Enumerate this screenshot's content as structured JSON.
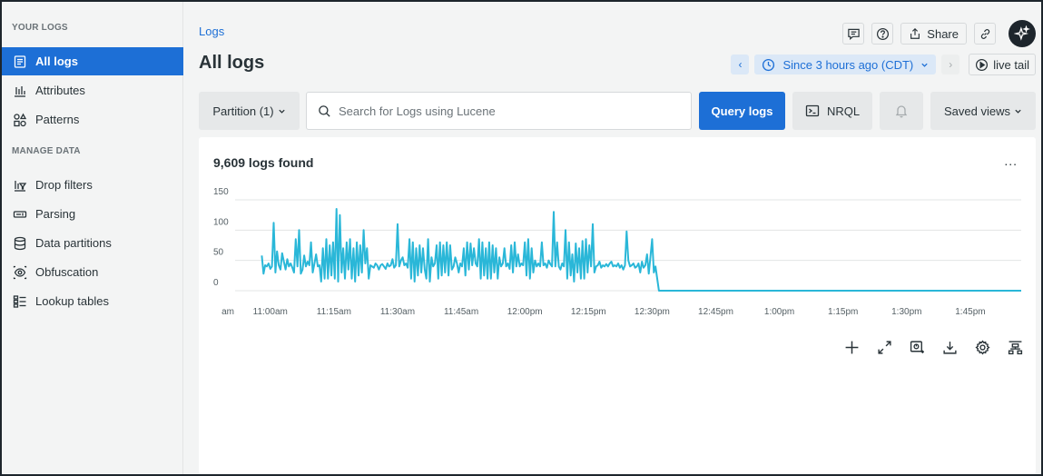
{
  "sidebar": {
    "section_your_logs": "YOUR LOGS",
    "section_manage": "MANAGE DATA",
    "items": [
      {
        "label": "All logs",
        "icon": "document-icon"
      },
      {
        "label": "Attributes",
        "icon": "bar-chart-icon"
      },
      {
        "label": "Patterns",
        "icon": "shapes-icon"
      },
      {
        "label": "Drop filters",
        "icon": "filter-chart-icon"
      },
      {
        "label": "Parsing",
        "icon": "parse-icon"
      },
      {
        "label": "Data partitions",
        "icon": "database-icon"
      },
      {
        "label": "Obfuscation",
        "icon": "eye-icon"
      },
      {
        "label": "Lookup tables",
        "icon": "table-icon"
      }
    ]
  },
  "header": {
    "breadcrumb": "Logs",
    "title": "All logs",
    "share_label": "Share",
    "time_range": "Since 3 hours ago (CDT)",
    "live_tail": "live tail"
  },
  "query": {
    "partition": "Partition (1)",
    "search_placeholder": "Search for Logs using Lucene",
    "query_button": "Query logs",
    "nrql_button": "NRQL",
    "saved_views": "Saved views"
  },
  "results": {
    "count_label": "9,609 logs found",
    "more": "..."
  },
  "colors": {
    "accent": "#1d6fd6",
    "series": "#2ab7d8"
  },
  "chart_data": {
    "type": "line",
    "y_ticks": [
      0,
      50,
      100,
      150
    ],
    "ylim": [
      0,
      150
    ],
    "x_tick_labels": [
      "am",
      "11:00am",
      "11:15am",
      "11:30am",
      "11:45am",
      "12:00pm",
      "12:15pm",
      "12:30pm",
      "12:45pm",
      "1:00pm",
      "1:15pm",
      "1:30pm",
      "1:45pm"
    ],
    "x_tick_minutes": [
      -10,
      0,
      15,
      30,
      45,
      60,
      75,
      90,
      105,
      120,
      135,
      150,
      165
    ],
    "xlim_minutes": [
      -13,
      177
    ],
    "grid": true,
    "series": [
      {
        "x_minutes": [
          -2,
          -1.6,
          -1.2,
          -0.8,
          -0.4,
          0,
          0.4,
          0.8,
          1.2,
          1.6,
          2,
          2.4,
          2.8,
          3.2,
          3.6,
          4,
          4.4,
          4.8,
          5.2,
          5.6,
          6,
          6.4,
          6.8,
          7.2,
          7.6,
          8,
          8.4,
          8.8,
          9.2,
          9.6,
          10,
          10.4,
          10.8,
          11.2,
          11.6,
          12,
          12.4,
          12.8,
          13.2,
          13.6,
          14,
          14.4,
          14.8,
          15.2,
          15.6,
          16,
          16.4,
          16.8,
          17.2,
          17.6,
          18,
          18.4,
          18.8,
          19.2,
          19.6,
          20,
          20.4,
          20.8,
          21.2,
          21.6,
          22,
          22.4,
          22.8,
          23.2,
          23.6,
          24,
          24.4,
          24.8,
          25.2,
          25.6,
          26,
          26.4,
          26.8,
          27.2,
          27.6,
          28,
          28.4,
          28.8,
          29.2,
          29.6,
          30,
          30.4,
          30.8,
          31.2,
          31.6,
          32,
          32.4,
          32.8,
          33.2,
          33.6,
          34,
          34.4,
          34.8,
          35.2,
          35.6,
          36,
          36.4,
          36.8,
          37.2,
          37.6,
          38,
          38.4,
          38.8,
          39.2,
          39.6,
          40,
          40.4,
          40.8,
          41.2,
          41.6,
          42,
          42.4,
          42.8,
          43.2,
          43.6,
          44,
          44.4,
          44.8,
          45.2,
          45.6,
          46,
          46.4,
          46.8,
          47.2,
          47.6,
          48,
          48.4,
          48.8,
          49.2,
          49.6,
          50,
          50.4,
          50.8,
          51.2,
          51.6,
          52,
          52.4,
          52.8,
          53.2,
          53.6,
          54,
          54.4,
          54.8,
          55.2,
          55.6,
          56,
          56.4,
          56.8,
          57.2,
          57.6,
          58,
          58.4,
          58.8,
          59.2,
          59.6,
          60,
          60.4,
          60.8,
          61.2,
          61.6,
          62,
          62.4,
          62.8,
          63.2,
          63.6,
          64,
          64.4,
          64.8,
          65.2,
          65.6,
          66,
          66.4,
          66.8,
          67.2,
          67.6,
          68,
          68.4,
          68.8,
          69.2,
          69.6,
          70,
          70.4,
          70.8,
          71.2,
          71.6,
          72,
          72.4,
          72.8,
          73.2,
          73.6,
          74,
          74.4,
          74.8,
          75.2,
          75.6,
          76,
          76.4,
          76.8,
          77.2,
          77.6,
          78,
          78.4,
          78.8,
          79.2,
          79.6,
          80,
          80.4,
          80.8,
          81.2,
          81.6,
          82,
          82.4,
          82.8,
          83.2,
          83.6,
          84,
          84.4,
          84.8,
          85.2,
          85.6,
          86,
          86.4,
          86.8,
          87.2,
          87.6,
          88,
          88.4,
          88.8,
          89.2,
          89.6,
          90,
          90.4,
          90.8,
          91.2,
          91.6,
          92,
          92.4,
          92.8,
          93.2,
          93.6,
          94,
          94.4,
          94.8,
          95.2,
          95.6,
          96,
          96.4,
          96.8,
          97.2,
          97.6,
          98,
          98.4,
          98.8,
          99.2,
          99.6,
          100,
          100.4,
          100.8,
          101.2,
          101.6,
          102,
          102.4,
          102.8,
          103.2,
          103.6,
          104,
          104.4,
          104.8,
          105.2,
          105.6,
          106,
          106.4,
          106.8,
          107.2,
          107.6,
          108,
          177
        ],
        "values": [
          58,
          28,
          42,
          40,
          45,
          36,
          40,
          112,
          30,
          65,
          42,
          35,
          62,
          48,
          35,
          52,
          40,
          45,
          38,
          30,
          85,
          40,
          100,
          28,
          35,
          58,
          40,
          48,
          42,
          80,
          30,
          45,
          60,
          40,
          42,
          15,
          70,
          20,
          85,
          20,
          75,
          25,
          80,
          20,
          135,
          15,
          125,
          30,
          70,
          20,
          80,
          35,
          85,
          20,
          70,
          15,
          80,
          25,
          75,
          30,
          100,
          45,
          70,
          20,
          42,
          40,
          38,
          45,
          42,
          35,
          42,
          44,
          40,
          36,
          45,
          40,
          42,
          52,
          38,
          42,
          110,
          40,
          50,
          55,
          42,
          45,
          38,
          85,
          20,
          80,
          15,
          70,
          25,
          75,
          30,
          70,
          35,
          20,
          85,
          15,
          55,
          40,
          45,
          75,
          20,
          80,
          25,
          75,
          30,
          80,
          25,
          75,
          35,
          40,
          55,
          45,
          30,
          45,
          40,
          70,
          25,
          80,
          35,
          78,
          42,
          70,
          45,
          40,
          85,
          20,
          80,
          25,
          70,
          20,
          80,
          20,
          75,
          30,
          70,
          20,
          55,
          40,
          45,
          70,
          40,
          45,
          36,
          75,
          30,
          80,
          40,
          60,
          40,
          45,
          42,
          80,
          25,
          85,
          20,
          70,
          30,
          50,
          40,
          45,
          40,
          80,
          42,
          45,
          38,
          50,
          44,
          40,
          130,
          40,
          80,
          40,
          35,
          45,
          40,
          100,
          20,
          80,
          25,
          60,
          15,
          78,
          30,
          70,
          20,
          82,
          20,
          85,
          30,
          75,
          40,
          110,
          30,
          40,
          42,
          48,
          38,
          42,
          40,
          44,
          40,
          45,
          48,
          40,
          42,
          40,
          45,
          38,
          42,
          35,
          42,
          98,
          50,
          40,
          42,
          45,
          38,
          40,
          45,
          30,
          48,
          38,
          42,
          60,
          28,
          55,
          85,
          30,
          40,
          20,
          0,
          0,
          0,
          0,
          0,
          0,
          0,
          0,
          0,
          0,
          0,
          0,
          0,
          0,
          0,
          0,
          0,
          0,
          0,
          0,
          0,
          0,
          0,
          0,
          0,
          0,
          0,
          0,
          0,
          0,
          0,
          0,
          0,
          0,
          0,
          0,
          0,
          0,
          0,
          0,
          0,
          0,
          0,
          0,
          0,
          0,
          0,
          0,
          0,
          0,
          0,
          0,
          0,
          0,
          0,
          0,
          0,
          0
        ]
      }
    ]
  }
}
